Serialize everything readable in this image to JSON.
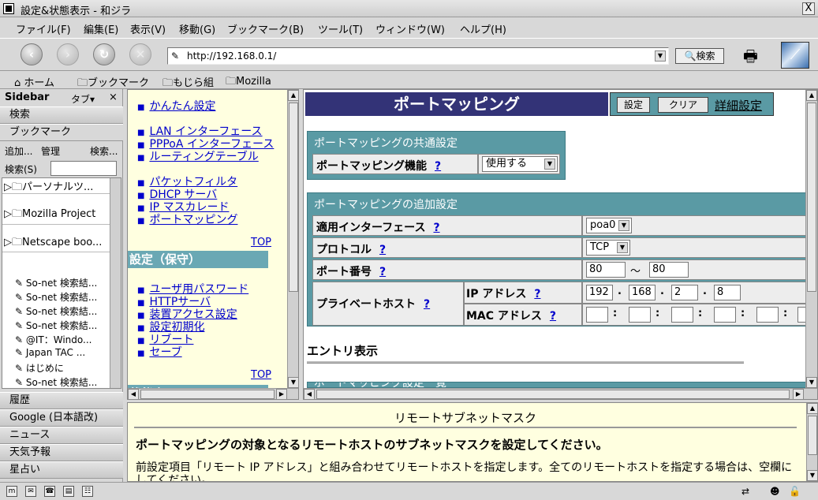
{
  "window": {
    "title": "設定&状態表示 - 和ジラ",
    "close": "X"
  },
  "menu": [
    "ファイル(F)",
    "編集(E)",
    "表示(V)",
    "移動(G)",
    "ブックマーク(B)",
    "ツール(T)",
    "ウィンドウ(W)",
    "ヘルプ(H)"
  ],
  "nav": {
    "back": "‹",
    "forward": "›",
    "reload": "↻",
    "stop": "✕",
    "url": "http://192.168.0.1/",
    "search_button": "検索"
  },
  "bookmarks": [
    "ホーム",
    "ブックマーク",
    "もじら組",
    "Mozilla"
  ],
  "sidebar": {
    "title": "Sidebar",
    "tab": "タブ▾",
    "close": "×",
    "panels_top": [
      "検索",
      "ブックマーク"
    ],
    "ops": [
      "追加...",
      "管理",
      "検索..."
    ],
    "search_label": "検索(S)",
    "folders": [
      "パーソナルツ...",
      "Mozilla Project",
      "Netscape boo..."
    ],
    "items": [
      "So-net 検索結...",
      "So-net 検索結...",
      "So-net 検索結...",
      "So-net 検索結...",
      "@IT：Windo...",
      "Japan TAC ...",
      "はじめに",
      "So-net 検索結..."
    ],
    "panels_bottom": [
      "履歴",
      "Google (日本語改)",
      "ニュース",
      "天気予報",
      "星占い"
    ]
  },
  "leftframe": {
    "links_a": [
      "かんたん設定"
    ],
    "links_b": [
      "LAN インターフェース",
      "PPPoA インターフェース",
      "ルーティングテーブル"
    ],
    "links_c": [
      "パケットフィルタ",
      "DHCP サーバ",
      "IP マスカレード",
      "ポートマッピング"
    ],
    "top": "TOP",
    "section": "設定（保守）",
    "links_d": [
      "ユーザ用パスワード",
      "HTTPサーバ",
      "装置アクセス設定",
      "設定初期化",
      "リブート",
      "セーブ"
    ],
    "top2": "TOP",
    "cutoff": "状態表示"
  },
  "main": {
    "title": "ポートマッピング",
    "btn_set": "設定",
    "btn_clear": "クリア",
    "advanced": "詳細設定",
    "common_header": "ポートマッピングの共通設定",
    "function_label": "ポートマッピング機能",
    "function_value": "使用する",
    "add_header": "ポートマッピングの追加設定",
    "q": "?",
    "rows": {
      "iface_label": "適用インターフェース",
      "iface_value": "poa0",
      "proto_label": "プロトコル",
      "proto_value": "TCP",
      "port_label": "ポート番号",
      "port_from": "80",
      "port_sep": "〜",
      "port_to": "80",
      "host_label": "プライベートホスト",
      "ip_label": "IP アドレス",
      "ip": [
        "192",
        "168",
        "2",
        "8"
      ],
      "mac_label": "MAC アドレス"
    },
    "entry_label": "エントリ表示",
    "list_cutoff": "ポートマッピング設定一覧"
  },
  "help": {
    "title": "リモートサブネットマスク",
    "bold": "ポートマッピングの対象となるリモートホストのサブネットマスクを設定してください。",
    "text": "前設定項目「リモート IP アドレス」と組み合わせてリモートホストを指定します。全てのリモートホストを指定する場合は、空欄にしてください。"
  }
}
